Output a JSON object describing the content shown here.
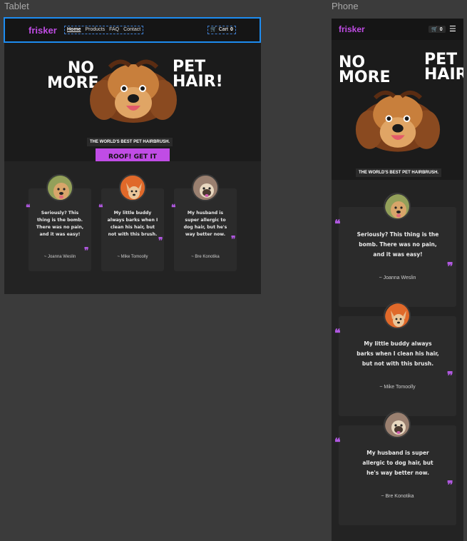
{
  "frames": {
    "tablet_label": "Tablet",
    "phone_label": "Phone"
  },
  "brand": {
    "logo": "frisker",
    "accent": "#c04ce5",
    "bg": "#1b1b1b"
  },
  "nav": {
    "links": [
      "Home",
      "Products",
      "FAQ",
      "Contact"
    ],
    "active": "Home",
    "cart_label": "Cart",
    "cart_count": "0",
    "cart_icon": "cart-icon",
    "menu_icon": "hamburger-menu-icon"
  },
  "hero": {
    "headline_left": "NO MORE",
    "headline_right": "PET HAIR!",
    "tagline": "THE WORLD'S BEST PET HAIRBRUSH.",
    "cta": "ROOF! GET IT NOW"
  },
  "testimonials": [
    {
      "quote": "Seriously? This thing is the bomb. There was no pain, and it was easy!",
      "author": "~ Joanna Weslin",
      "avatar": "dog-avatar-golden"
    },
    {
      "quote": "My little buddy always barks when I clean his hair, but not with this brush.",
      "author": "~ Mike Tomoolly",
      "avatar": "dog-avatar-chihuahua"
    },
    {
      "quote": "My husband is super allergic to dog hair, but he's way better now.",
      "author": "~ Bre Konotika",
      "avatar": "dog-avatar-pug"
    }
  ]
}
